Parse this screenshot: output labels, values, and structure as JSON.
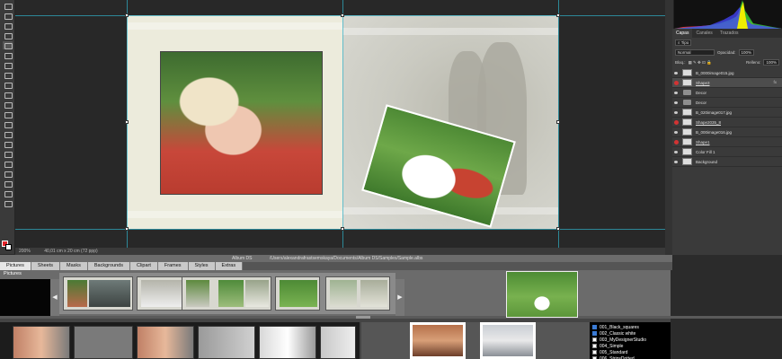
{
  "photoshop": {
    "tools": [
      "move",
      "marquee",
      "lasso",
      "quick-select",
      "crop",
      "eyedropper",
      "heal",
      "brush",
      "stamp",
      "history-brush",
      "eraser",
      "gradient",
      "blur",
      "dodge",
      "pen",
      "type",
      "path-select",
      "shape",
      "hand",
      "zoom",
      "more"
    ],
    "status": {
      "zoom": "200%",
      "doc_info": "40,01 cm x 20 cm (72 ppp)"
    },
    "panel_tabs": [
      "Capas",
      "Canales",
      "Trazados"
    ],
    "filter_label": "Tipo",
    "blend_mode": "Normal",
    "opacity_label": "Opacidad:",
    "opacity_value": "100%",
    "lock_label": "Bloq.:",
    "fill_label": "Relleno:",
    "fill_value": "100%",
    "layers": [
      {
        "name": "B_0000image015.jpg",
        "eye": "normal",
        "thumb": "photo",
        "selected": false,
        "link": false,
        "fx": ""
      },
      {
        "name": "Shape3",
        "eye": "red",
        "thumb": "photo",
        "selected": true,
        "link": true,
        "fx": "fx"
      },
      {
        "name": "Decor",
        "eye": "normal",
        "thumb": "folder",
        "selected": false,
        "link": false,
        "fx": ""
      },
      {
        "name": "Decor",
        "eye": "normal",
        "thumb": "folder",
        "selected": false,
        "link": false,
        "fx": ""
      },
      {
        "name": "B_020image017.jpg",
        "eye": "normal",
        "thumb": "photo",
        "selected": false,
        "link": false,
        "fx": ""
      },
      {
        "name": "Shape2035_8",
        "eye": "red",
        "thumb": "photo",
        "selected": false,
        "link": true,
        "fx": ""
      },
      {
        "name": "B_000image016.jpg",
        "eye": "normal",
        "thumb": "photo",
        "selected": false,
        "link": false,
        "fx": ""
      },
      {
        "name": "Shape1",
        "eye": "red",
        "thumb": "photo",
        "selected": false,
        "link": true,
        "fx": ""
      },
      {
        "name": "Color Fill 1",
        "eye": "normal",
        "thumb": "photo",
        "selected": false,
        "link": false,
        "fx": ""
      },
      {
        "name": "Background",
        "eye": "normal",
        "thumb": "photo",
        "selected": false,
        "link": false,
        "fx": ""
      }
    ]
  },
  "album": {
    "app_name": "Album DS",
    "path": "/Users/alexandrafrastsemskaya/Documents/Album DS/Samples/Sample.albs",
    "tabs": [
      "Pictures",
      "Sheets",
      "Masks",
      "Backgrounds",
      "Clipart",
      "Frames",
      "Styles",
      "Extras"
    ],
    "active_tab": "Pictures",
    "strip_label": "Pictures",
    "arrow_left": "◀",
    "arrow_right": "▶",
    "styles": [
      {
        "name": "001_Black_squares",
        "checked": true
      },
      {
        "name": "002_Classic white",
        "checked": true
      },
      {
        "name": "003_MyDesignerStudio",
        "checked": false
      },
      {
        "name": "004_Simple",
        "checked": false
      },
      {
        "name": "005_Standard",
        "checked": false
      },
      {
        "name": "006_StripsDotted",
        "checked": false
      }
    ]
  },
  "colors": {
    "foreground": "#e3252b",
    "background": "#ffffff",
    "guide": "#2fb0c7",
    "page_bg": "#ecebdc"
  }
}
